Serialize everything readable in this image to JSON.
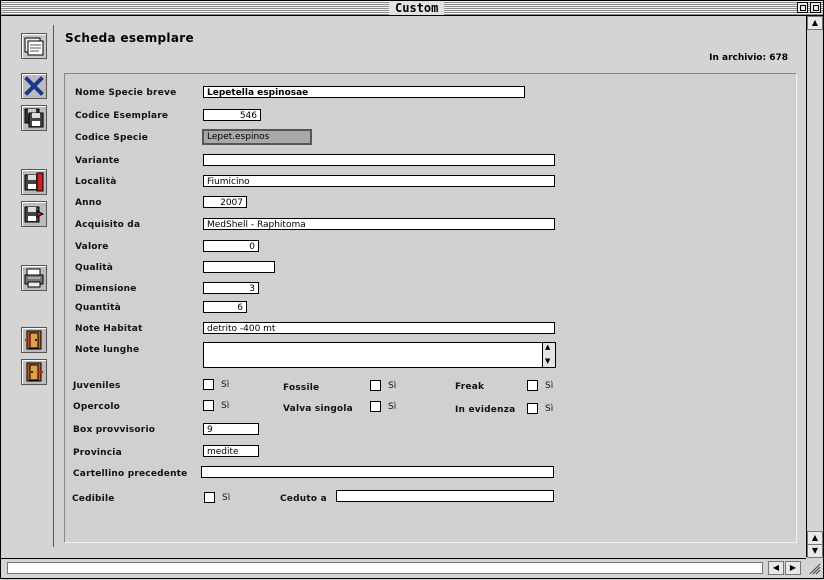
{
  "window": {
    "title": "Custom"
  },
  "header": {
    "title": "Scheda esemplare",
    "archive_count": "In archivio: 678"
  },
  "fields": {
    "nome_specie_breve": {
      "label": "Nome Specie breve",
      "value": "Lepetella espinosae"
    },
    "codice_esemplare": {
      "label": "Codice Esemplare",
      "value": "546"
    },
    "codice_specie": {
      "label": "Codice Specie",
      "value": "Lepet.espinos"
    },
    "variante": {
      "label": "Variante",
      "value": ""
    },
    "localita": {
      "label": "Località",
      "value": "Fiumicino"
    },
    "anno": {
      "label": "Anno",
      "value": "2007"
    },
    "acquisito_da": {
      "label": "Acquisito da",
      "value": "MedShell - Raphitoma"
    },
    "valore": {
      "label": "Valore",
      "value": "0"
    },
    "qualita": {
      "label": "Qualità",
      "value": ""
    },
    "dimensione": {
      "label": "Dimensione",
      "value": "3"
    },
    "quantita": {
      "label": "Quantità",
      "value": "6"
    },
    "note_habitat": {
      "label": "Note Habitat",
      "value": "detrito -400 mt"
    },
    "note_lunghe": {
      "label": "Note lunghe",
      "value": ""
    },
    "box_provvisorio": {
      "label": "Box provvisorio",
      "value": "9"
    },
    "provincia": {
      "label": "Provincia",
      "value": "medite"
    },
    "cartellino_precedente": {
      "label": "Cartellino precedente",
      "value": ""
    },
    "ceduto_a": {
      "label": "Ceduto a",
      "value": ""
    }
  },
  "checks": {
    "juveniles": {
      "label": "Juveniles",
      "option": "Sì",
      "checked": false
    },
    "fossile": {
      "label": "Fossile",
      "option": "Sì",
      "checked": false
    },
    "freak": {
      "label": "Freak",
      "option": "Sì",
      "checked": false
    },
    "opercolo": {
      "label": "Opercolo",
      "option": "Sì",
      "checked": false
    },
    "valva_singola": {
      "label": "Valva singola",
      "option": "Sì",
      "checked": false
    },
    "in_evidenza": {
      "label": "In evidenza",
      "option": "Sì",
      "checked": false
    },
    "cedibile": {
      "label": "Cedibile",
      "option": "Sì",
      "checked": false
    }
  },
  "toolbar": {
    "icons": [
      "form-view-icon",
      "delete-record-icon",
      "save-disk-icon",
      "disk-export-icon",
      "disk-import-icon",
      "print-icon",
      "door-exit-icon",
      "door-enter-icon"
    ]
  },
  "colors": {
    "background": "#d4d4d4",
    "panel": "#d0d0d0",
    "field": "#ffffff",
    "delete_icon": "#1c3a8a"
  }
}
